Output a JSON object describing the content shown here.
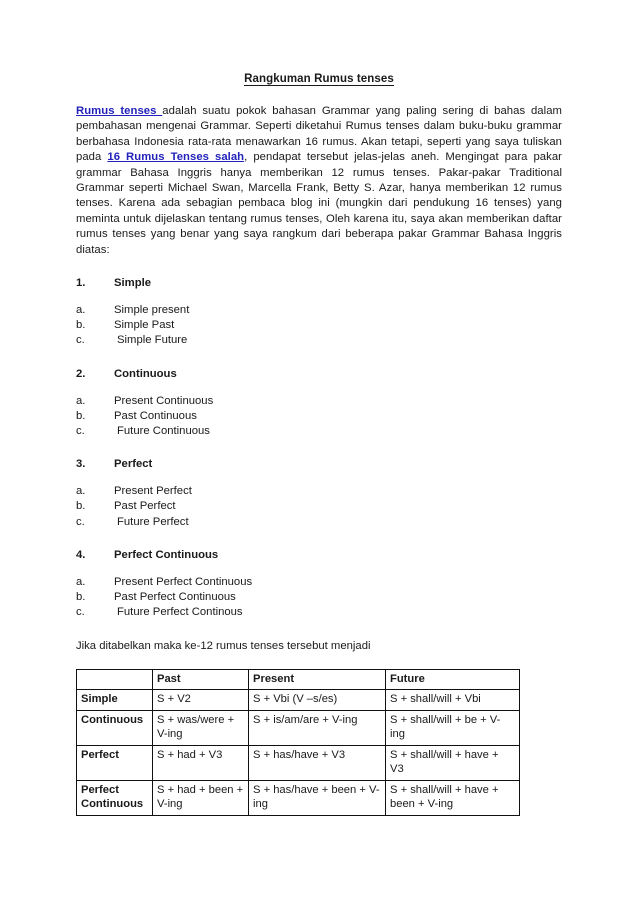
{
  "document": {
    "title": "Rangkuman Rumus tenses",
    "intro": {
      "link1": "Rumus tenses ",
      "part1": "adalah suatu pokok bahasan Grammar yang paling sering di bahas dalam pembahasan mengenai Grammar. Seperti diketahui Rumus tenses dalam buku-buku grammar berbahasa Indonesia rata-rata menawarkan 16 rumus. Akan tetapi, seperti yang saya tuliskan pada ",
      "link2": "16 Rumus Tenses salah",
      "part2": ", pendapat tersebut jelas-jelas aneh. Mengingat para pakar grammar Bahasa Inggris hanya memberikan 12 rumus tenses. Pakar-pakar Traditional Grammar seperti Michael Swan, Marcella Frank, Betty S. Azar, hanya memberikan 12 rumus tenses. Karena ada sebagian pembaca blog ini (mungkin dari pendukung 16 tenses) yang meminta untuk dijelaskan tentang rumus tenses, Oleh karena itu, saya akan memberikan daftar rumus tenses yang benar yang saya rangkum dari beberapa pakar Grammar Bahasa Inggris diatas:"
    },
    "sections": [
      {
        "number": "1.",
        "heading": "Simple",
        "items": [
          {
            "marker": "a.",
            "label": "Simple present"
          },
          {
            "marker": "b.",
            "label": "Simple Past"
          },
          {
            "marker": "c.",
            "label": "Simple Future"
          }
        ]
      },
      {
        "number": "2.",
        "heading": "Continuous",
        "items": [
          {
            "marker": "a.",
            "label": "Present Continuous"
          },
          {
            "marker": "b.",
            "label": "Past Continuous"
          },
          {
            "marker": "c.",
            "label": "Future Continuous"
          }
        ]
      },
      {
        "number": "3.",
        "heading": "Perfect",
        "items": [
          {
            "marker": "a.",
            "label": "Present Perfect"
          },
          {
            "marker": "b.",
            "label": "Past Perfect"
          },
          {
            "marker": "c.",
            "label": "Future Perfect"
          }
        ]
      },
      {
        "number": "4.",
        "heading": "Perfect Continuous",
        "items": [
          {
            "marker": "a.",
            "label": "Present Perfect Continuous"
          },
          {
            "marker": "b.",
            "label": "Past Perfect Continuous"
          },
          {
            "marker": "c.",
            "label": "Future Perfect Continous"
          }
        ]
      }
    ],
    "table_lead": "Jika ditabelkan maka ke-12 rumus tenses tersebut menjadi",
    "table": {
      "headers": [
        "",
        "Past",
        "Present",
        "Future"
      ],
      "rows": [
        {
          "label": "Simple",
          "past": "S + V2",
          "present": "S + Vbi (V –s/es)",
          "future": "S + shall/will + Vbi"
        },
        {
          "label": "Continuous",
          "past": "S + was/were + V-ing",
          "present": "S + is/am/are + V-ing",
          "future": "S + shall/will + be + V-ing"
        },
        {
          "label": "Perfect",
          "past": "S + had + V3",
          "present": "S + has/have + V3",
          "future": "S + shall/will + have + V3"
        },
        {
          "label": "Perfect Continuous",
          "past": "S + had + been + V-ing",
          "present": "S + has/have + been + V-ing",
          "future": "S + shall/will + have + been + V-ing"
        }
      ]
    },
    "colors": {
      "link": "#2222bb",
      "text": "#1a1a1a",
      "background": "#ffffff",
      "table_border": "#111111"
    }
  }
}
